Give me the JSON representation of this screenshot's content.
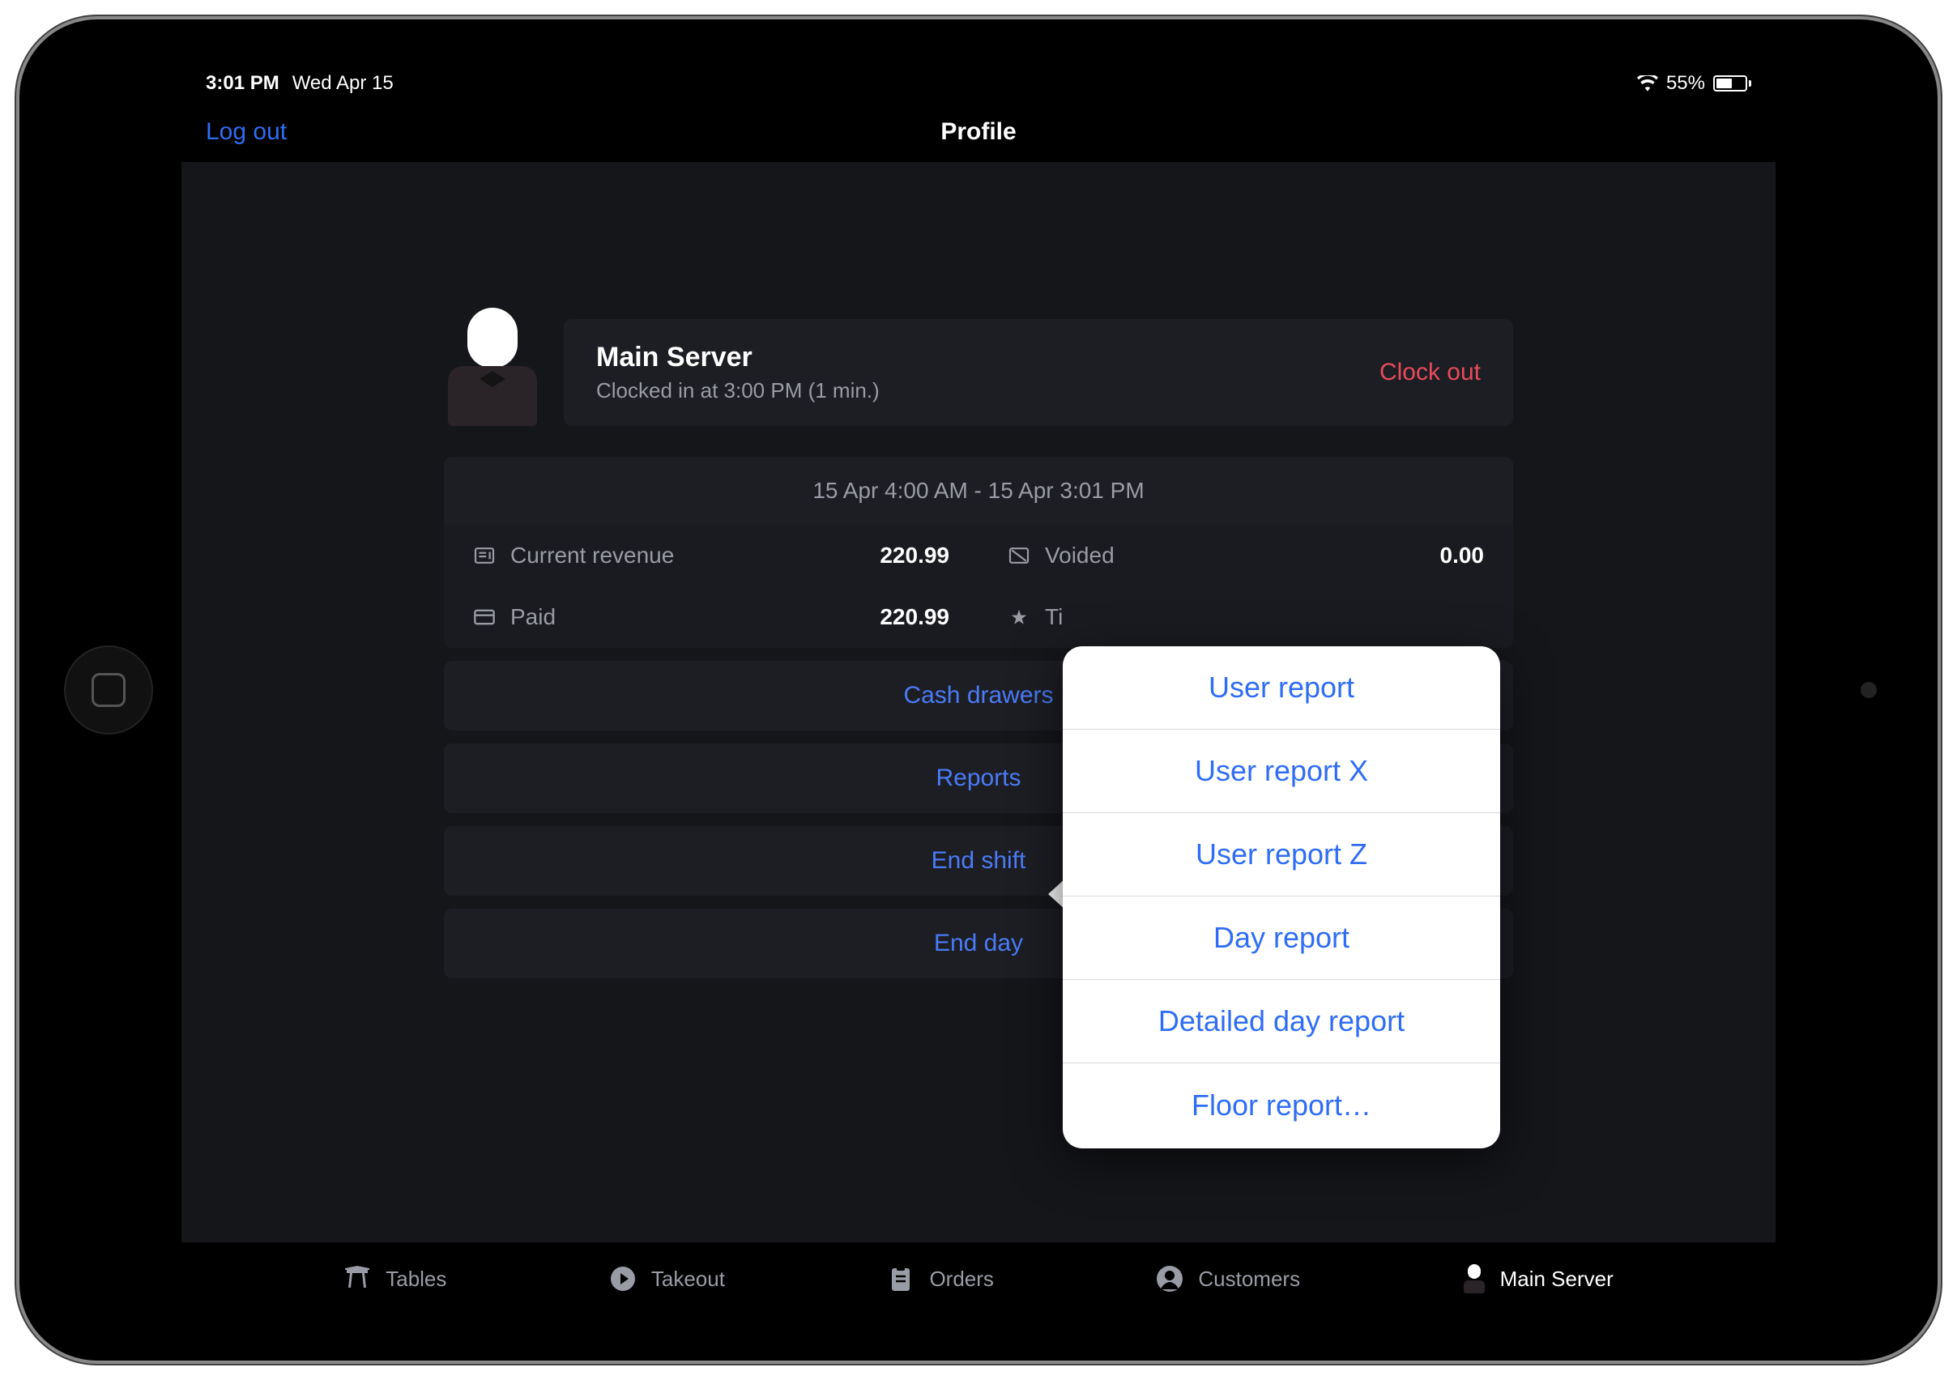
{
  "status_bar": {
    "time": "3:01 PM",
    "date": "Wed Apr 15",
    "battery_pct": "55%"
  },
  "nav": {
    "logout": "Log out",
    "title": "Profile"
  },
  "profile": {
    "name": "Main Server",
    "subtitle": "Clocked in at 3:00 PM (1 min.)",
    "clock_out": "Clock out"
  },
  "stats": {
    "range": "15 Apr 4:00 AM - 15 Apr 3:01 PM",
    "current_revenue_label": "Current revenue",
    "current_revenue_value": "220.99",
    "paid_label": "Paid",
    "paid_value": "220.99",
    "voided_label": "Voided",
    "voided_value": "0.00",
    "tips_label": "Ti"
  },
  "actions": {
    "cash_drawers": "Cash drawers",
    "reports": "Reports",
    "end_shift": "End shift",
    "end_day": "End day"
  },
  "popover": {
    "items": [
      "User report",
      "User report X",
      "User report Z",
      "Day report",
      "Detailed day report",
      "Floor report…"
    ]
  },
  "tabs": {
    "tables": "Tables",
    "takeout": "Takeout",
    "orders": "Orders",
    "customers": "Customers",
    "main_server": "Main Server"
  }
}
